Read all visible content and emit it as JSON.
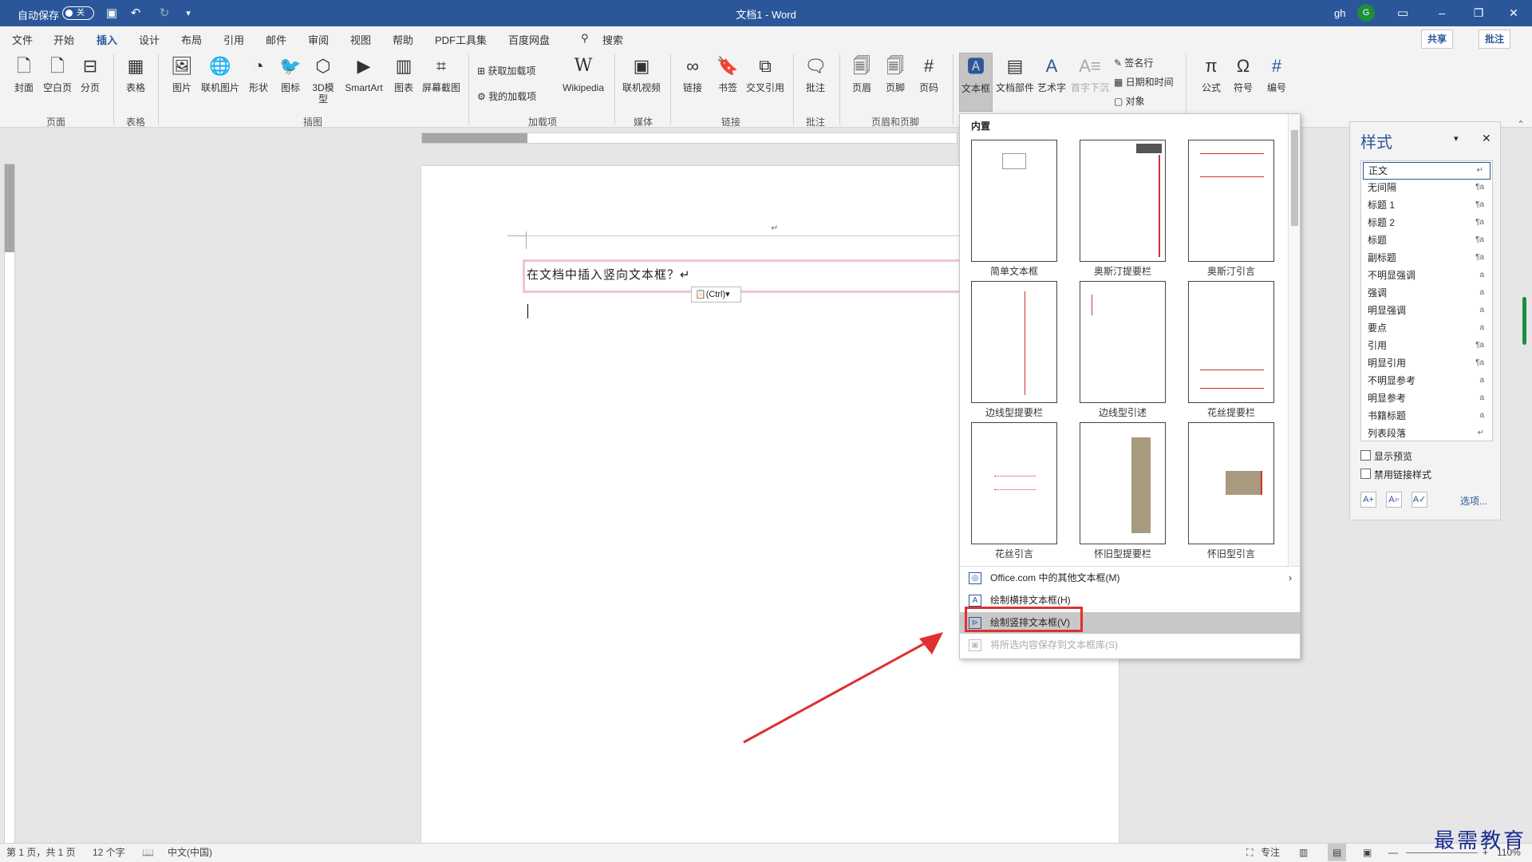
{
  "titlebar": {
    "autosave_label": "自动保存",
    "autosave_state": "关",
    "doc_title": "文档1  -  Word",
    "user_name": "gh",
    "avatar_initial": "G",
    "min_icon": "–",
    "restore_icon": "❐",
    "close_icon": "✕"
  },
  "menubar": {
    "tabs": [
      "文件",
      "开始",
      "插入",
      "设计",
      "布局",
      "引用",
      "邮件",
      "审阅",
      "视图",
      "帮助",
      "PDF工具集",
      "百度网盘"
    ],
    "search_label": "搜索",
    "share_label": "共享",
    "comments_label": "批注"
  },
  "ribbon": {
    "buttons": [
      "封面",
      "空白页",
      "分页",
      "表格",
      "图片",
      "联机图片",
      "形状",
      "图标",
      "3D模型",
      "SmartArt",
      "图表",
      "屏幕截图",
      "Wikipedia",
      "联机视频",
      "链接",
      "书签",
      "交叉引用",
      "批注",
      "页眉",
      "页脚",
      "页码",
      "文本框",
      "文档部件",
      "艺术字",
      "首字下沉",
      "公式",
      "符号",
      "编号"
    ],
    "small": [
      "获取加载项",
      "我的加载项",
      "签名行",
      "日期和时间",
      "对象"
    ],
    "groups": [
      "页面",
      "表格",
      "插图",
      "加载项",
      "媒体",
      "链接",
      "批注",
      "页眉和页脚"
    ]
  },
  "document": {
    "line1": "在文档中插入竖向文本框？↵",
    "paste_label": "(Ctrl)▾",
    "return_mark": "↵"
  },
  "gallery": {
    "header": "内置",
    "items": [
      "简单文本框",
      "奥斯汀提要栏",
      "奥斯汀引言",
      "边线型提要栏",
      "边线型引述",
      "花丝提要栏",
      "花丝引言",
      "怀旧型提要栏",
      "怀旧型引言"
    ],
    "menu": [
      "Office.com 中的其他文本框(M)",
      "绘制横排文本框(H)",
      "绘制竖排文本框(V)",
      "将所选内容保存到文本框库(S)"
    ]
  },
  "styles_pane": {
    "title": "样式",
    "items": [
      {
        "name": "正文",
        "mark": "↵"
      },
      {
        "name": "无间隔",
        "mark": "¶a"
      },
      {
        "name": "标题 1",
        "mark": "¶a"
      },
      {
        "name": "标题 2",
        "mark": "¶a"
      },
      {
        "name": "标题",
        "mark": "¶a"
      },
      {
        "name": "副标题",
        "mark": "¶a"
      },
      {
        "name": "不明显强调",
        "mark": "a"
      },
      {
        "name": "强调",
        "mark": "a"
      },
      {
        "name": "明显强调",
        "mark": "a"
      },
      {
        "name": "要点",
        "mark": "a"
      },
      {
        "name": "引用",
        "mark": "¶a"
      },
      {
        "name": "明显引用",
        "mark": "¶a"
      },
      {
        "name": "不明显参考",
        "mark": "a"
      },
      {
        "name": "明显参考",
        "mark": "a"
      },
      {
        "name": "书籍标题",
        "mark": "a"
      },
      {
        "name": "列表段落",
        "mark": "↵"
      }
    ],
    "show_preview": "显示预览",
    "disable_linked": "禁用链接样式",
    "options": "选项..."
  },
  "status": {
    "page": "第 1 页，共 1 页",
    "words": "12 个字",
    "lang": "中文(中国)",
    "focus": "专注",
    "zoom": "110%"
  },
  "watermark": "最需教育",
  "colors": {
    "accent": "#2b579a",
    "highlight": "#e03030"
  }
}
